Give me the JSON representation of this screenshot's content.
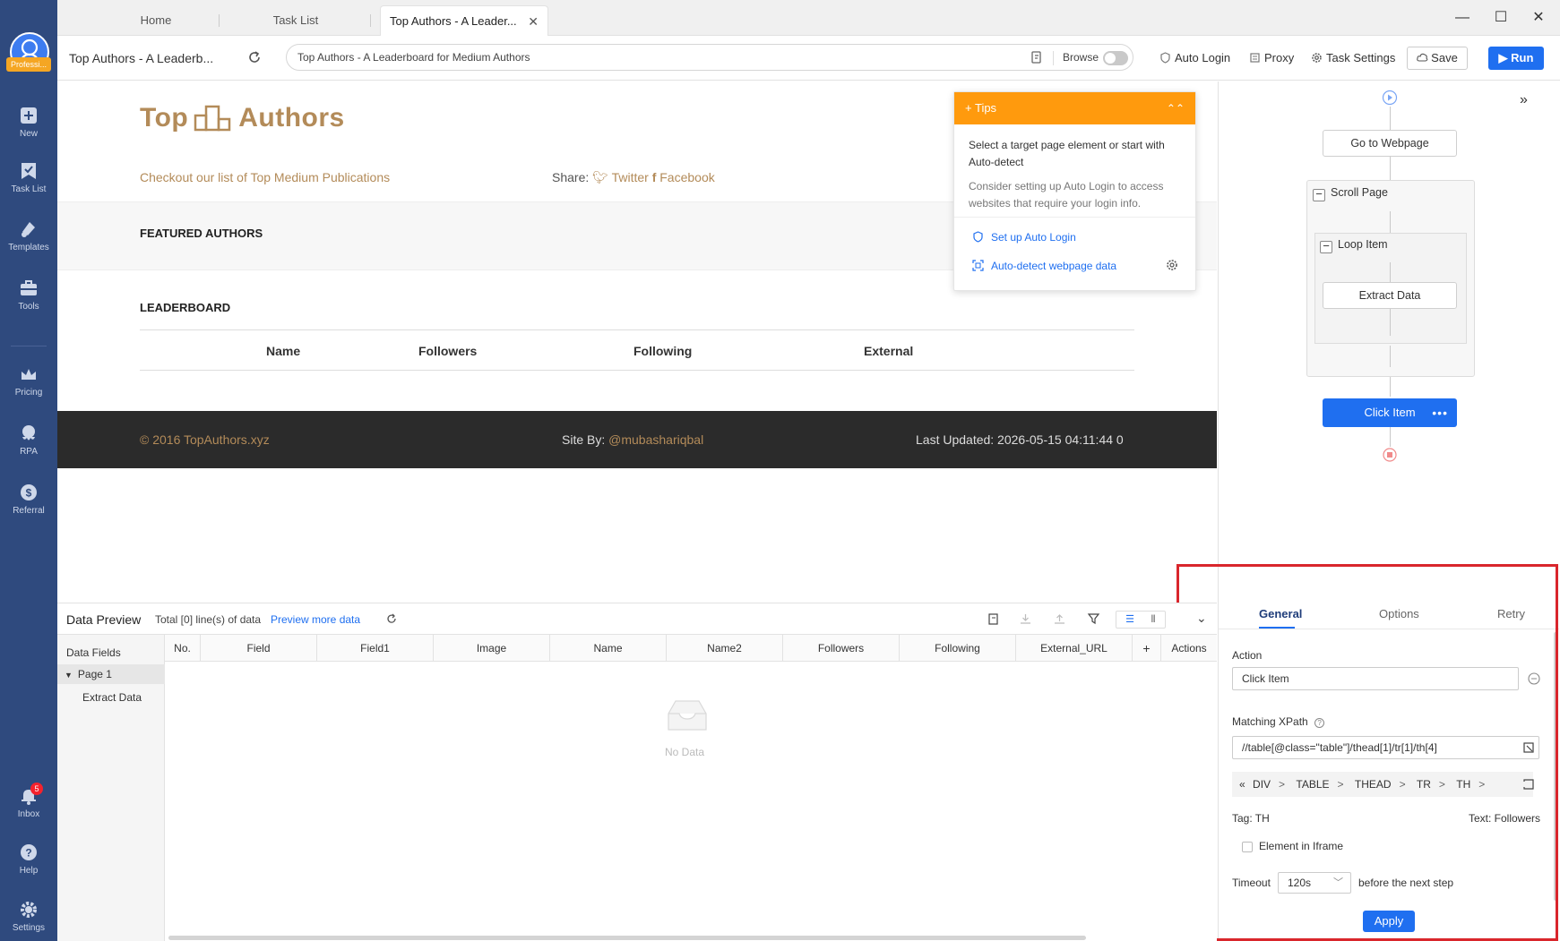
{
  "sidebar": {
    "logo_badge": "Professi...",
    "items": [
      {
        "label": "New",
        "icon": "plus-square-icon"
      },
      {
        "label": "Task List",
        "icon": "task-list-icon"
      },
      {
        "label": "Templates",
        "icon": "templates-icon"
      },
      {
        "label": "Tools",
        "icon": "toolbox-icon"
      },
      {
        "label": "Pricing",
        "icon": "crown-icon"
      },
      {
        "label": "RPA",
        "icon": "robot-icon"
      },
      {
        "label": "Referral",
        "icon": "dollar-icon"
      },
      {
        "label": "Inbox",
        "icon": "bell-icon",
        "badge": "5"
      },
      {
        "label": "Help",
        "icon": "help-icon"
      },
      {
        "label": "Settings",
        "icon": "gear-icon"
      }
    ]
  },
  "tabs": [
    {
      "label": "Home"
    },
    {
      "label": "Task List"
    },
    {
      "label": "Top Authors - A Leader..."
    }
  ],
  "toolbar": {
    "page_title": "Top Authors - A Leaderb...",
    "url": "Top Authors - A Leaderboard for Medium Authors",
    "browse_label": "Browse",
    "auto_login": "Auto Login",
    "proxy": "Proxy",
    "task_settings": "Task Settings",
    "save": "Save",
    "run": "Run"
  },
  "site": {
    "logo_left": "Top",
    "logo_right": "Authors",
    "checkout": "Checkout our list of Top Medium Publications",
    "share_label": "Share:",
    "twitter": "Twitter",
    "facebook": "Facebook",
    "featured": "FEATURED AUTHORS",
    "leaderboard": "LEADERBOARD",
    "columns": [
      "Name",
      "Followers",
      "Following",
      "External"
    ],
    "footer_copyright": "© 2016 TopAuthors.xyz",
    "footer_site_by": "Site By:",
    "footer_author": "@mubashariqbal",
    "footer_updated": "Last Updated: 2026-05-15 04:11:44 0"
  },
  "tips": {
    "title": "Tips",
    "text1": "Select a target page element or start with Auto-detect",
    "text2": "Consider setting up Auto Login to access websites that require your login info.",
    "link1": "Set up Auto Login",
    "link2": "Auto-detect webpage data"
  },
  "workflow": {
    "go_to_webpage": "Go to Webpage",
    "scroll_page": "Scroll Page",
    "loop_item": "Loop Item",
    "extract_data": "Extract Data",
    "click_item": "Click Item"
  },
  "settings": {
    "tabs": [
      "General",
      "Options",
      "Retry"
    ],
    "action_label": "Action",
    "action_value": "Click Item",
    "xpath_label": "Matching XPath",
    "xpath_value": "//table[@class=\"table\"]/thead[1]/tr[1]/th[4]",
    "crumbs": [
      "DIV",
      "TABLE",
      "THEAD",
      "TR",
      "TH"
    ],
    "tag": "Tag: TH",
    "text": "Text: Followers",
    "iframe_label": "Element in Iframe",
    "timeout_label": "Timeout",
    "timeout_value": "120s",
    "timeout_suffix": "before the next step",
    "apply": "Apply"
  },
  "preview": {
    "title": "Data Preview",
    "total": "Total [0] line(s) of data",
    "more": "Preview more data",
    "fields_title": "Data Fields",
    "page": "Page 1",
    "extract": "Extract Data",
    "columns": [
      "No.",
      "Field",
      "Field1",
      "Image",
      "Name",
      "Name2",
      "Followers",
      "Following",
      "External_URL",
      "+",
      "Actions"
    ],
    "no_data": "No Data"
  },
  "colors": {
    "sidebar": "#2f4a7e",
    "accent": "#1f6ff0",
    "brand_gold": "#b38b59",
    "tips_orange": "#ff9a0d",
    "highlight_red": "#d9262c"
  }
}
